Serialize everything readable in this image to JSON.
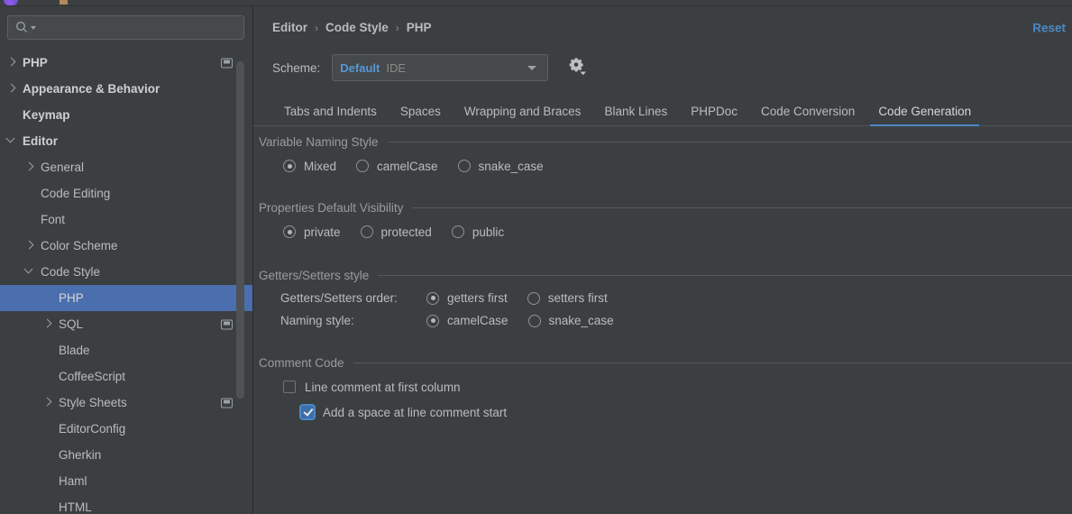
{
  "window": {
    "background": "#3c3f41",
    "accent_blue": "#4a88c7",
    "selection_blue": "#4b6eaf"
  },
  "sidebar": {
    "search": {
      "placeholder": "",
      "value": "",
      "icon": "search-icon",
      "dropdown_icon": "chevron-down-icon"
    },
    "items": [
      {
        "label": "PHP",
        "arrow": "right",
        "indent": 0,
        "bold": true,
        "selected": false,
        "badge": true
      },
      {
        "label": "Appearance & Behavior",
        "arrow": "right",
        "indent": 0,
        "bold": true,
        "selected": false,
        "badge": false
      },
      {
        "label": "Keymap",
        "arrow": "none",
        "indent": 0,
        "bold": true,
        "selected": false,
        "badge": false
      },
      {
        "label": "Editor",
        "arrow": "down",
        "indent": 0,
        "bold": true,
        "selected": false,
        "badge": false
      },
      {
        "label": "General",
        "arrow": "right",
        "indent": 1,
        "bold": false,
        "selected": false,
        "badge": false
      },
      {
        "label": "Code Editing",
        "arrow": "none",
        "indent": 1,
        "bold": false,
        "selected": false,
        "badge": false
      },
      {
        "label": "Font",
        "arrow": "none",
        "indent": 1,
        "bold": false,
        "selected": false,
        "badge": false
      },
      {
        "label": "Color Scheme",
        "arrow": "right",
        "indent": 1,
        "bold": false,
        "selected": false,
        "badge": false
      },
      {
        "label": "Code Style",
        "arrow": "down",
        "indent": 1,
        "bold": false,
        "selected": false,
        "badge": false
      },
      {
        "label": "PHP",
        "arrow": "none",
        "indent": 2,
        "bold": false,
        "selected": true,
        "badge": false
      },
      {
        "label": "SQL",
        "arrow": "right",
        "indent": 2,
        "bold": false,
        "selected": false,
        "badge": true
      },
      {
        "label": "Blade",
        "arrow": "none",
        "indent": 2,
        "bold": false,
        "selected": false,
        "badge": false
      },
      {
        "label": "CoffeeScript",
        "arrow": "none",
        "indent": 2,
        "bold": false,
        "selected": false,
        "badge": false
      },
      {
        "label": "Style Sheets",
        "arrow": "right",
        "indent": 2,
        "bold": false,
        "selected": false,
        "badge": true
      },
      {
        "label": "EditorConfig",
        "arrow": "none",
        "indent": 2,
        "bold": false,
        "selected": false,
        "badge": false
      },
      {
        "label": "Gherkin",
        "arrow": "none",
        "indent": 2,
        "bold": false,
        "selected": false,
        "badge": false
      },
      {
        "label": "Haml",
        "arrow": "none",
        "indent": 2,
        "bold": false,
        "selected": false,
        "badge": false
      },
      {
        "label": "HTML",
        "arrow": "none",
        "indent": 2,
        "bold": false,
        "selected": false,
        "badge": false
      }
    ]
  },
  "header": {
    "breadcrumb": [
      "Editor",
      "Code Style",
      "PHP"
    ],
    "separator": "›",
    "reset_label": "Reset"
  },
  "scheme": {
    "label": "Scheme:",
    "value_name": "Default",
    "value_scope": "IDE",
    "dropdown_icon": "chevron-down-icon",
    "gear_icon": "gear-dropdown-icon"
  },
  "tabs": [
    {
      "label": "Tabs and Indents",
      "active": false
    },
    {
      "label": "Spaces",
      "active": false
    },
    {
      "label": "Wrapping and Braces",
      "active": false
    },
    {
      "label": "Blank Lines",
      "active": false
    },
    {
      "label": "PHPDoc",
      "active": false
    },
    {
      "label": "Code Conversion",
      "active": false
    },
    {
      "label": "Code Generation",
      "active": true
    }
  ],
  "sections": {
    "variable_naming": {
      "title": "Variable Naming Style",
      "options": [
        {
          "label": "Mixed",
          "checked": true
        },
        {
          "label": "camelCase",
          "checked": false
        },
        {
          "label": "snake_case",
          "checked": false
        }
      ]
    },
    "properties_visibility": {
      "title": "Properties Default Visibility",
      "options": [
        {
          "label": "private",
          "checked": true
        },
        {
          "label": "protected",
          "checked": false
        },
        {
          "label": "public",
          "checked": false
        }
      ]
    },
    "getters_setters": {
      "title": "Getters/Setters style",
      "rows": [
        {
          "label": "Getters/Setters order:",
          "options": [
            {
              "label": "getters first",
              "checked": true
            },
            {
              "label": "setters first",
              "checked": false
            }
          ]
        },
        {
          "label": "Naming style:",
          "options": [
            {
              "label": "camelCase",
              "checked": true
            },
            {
              "label": "snake_case",
              "checked": false
            }
          ]
        }
      ]
    },
    "comment_code": {
      "title": "Comment Code",
      "checkboxes": [
        {
          "label": "Line comment at first column",
          "checked": false,
          "indent": 1
        },
        {
          "label": "Add a space at line comment start",
          "checked": true,
          "indent": 2
        }
      ]
    }
  }
}
